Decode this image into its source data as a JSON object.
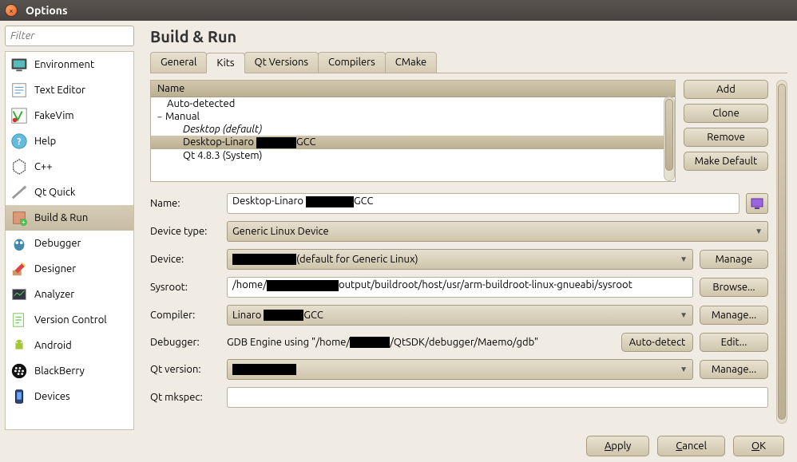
{
  "window": {
    "title": "Options"
  },
  "sidebar": {
    "filter_placeholder": "Filter",
    "items": [
      {
        "label": "Environment"
      },
      {
        "label": "Text Editor"
      },
      {
        "label": "FakeVim"
      },
      {
        "label": "Help"
      },
      {
        "label": "C++"
      },
      {
        "label": "Qt Quick"
      },
      {
        "label": "Build & Run"
      },
      {
        "label": "Debugger"
      },
      {
        "label": "Designer"
      },
      {
        "label": "Analyzer"
      },
      {
        "label": "Version Control"
      },
      {
        "label": "Android"
      },
      {
        "label": "BlackBerry"
      },
      {
        "label": "Devices"
      }
    ]
  },
  "main": {
    "heading": "Build & Run",
    "tabs": [
      "General",
      "Kits",
      "Qt Versions",
      "Compilers",
      "CMake"
    ],
    "kits": {
      "header": "Name",
      "auto_detected": "Auto-detected",
      "manual": "Manual",
      "rows": {
        "desktop_default": "Desktop (default)",
        "desktop_linaro_prefix": "Desktop-Linaro ",
        "desktop_linaro_suffix": "GCC",
        "qt_system": "Qt 4.8.3 (System)"
      }
    },
    "buttons": {
      "add": "Add",
      "clone": "Clone",
      "remove": "Remove",
      "make_default": "Make Default"
    },
    "form": {
      "name_label": "Name:",
      "name_prefix": "Desktop-Linaro ",
      "name_suffix": "GCC",
      "device_type_label": "Device type:",
      "device_type_value": "Generic Linux Device",
      "device_label": "Device:",
      "device_suffix": "(default for Generic Linux)",
      "sysroot_label": "Sysroot:",
      "sysroot_prefix": "/home/",
      "sysroot_suffix": "output/buildroot/host/usr/arm-buildroot-linux-gnueabi/sysroot",
      "compiler_label": "Compiler:",
      "compiler_prefix": "Linaro ",
      "compiler_suffix": "GCC",
      "debugger_label": "Debugger:",
      "debugger_prefix": "GDB Engine using \"/home/",
      "debugger_suffix": "/QtSDK/debugger/Maemo/gdb\"",
      "qt_version_label": "Qt version:",
      "qt_mkspec_label": "Qt mkspec:",
      "manage": "Manage",
      "manage_dots": "Manage...",
      "browse": "Browse...",
      "auto_detect": "Auto-detect",
      "edit": "Edit..."
    }
  },
  "footer": {
    "apply": "Apply",
    "cancel": "Cancel",
    "ok": "OK"
  }
}
